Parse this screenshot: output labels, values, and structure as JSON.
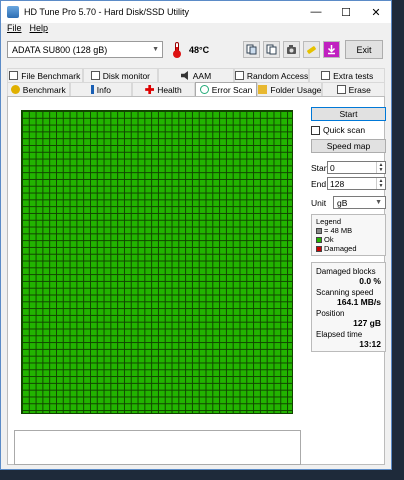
{
  "window": {
    "title": "HD Tune Pro 5.70 - Hard Disk/SSD Utility",
    "minimize": "—",
    "maximize": "☐",
    "close": "✕"
  },
  "menu": {
    "file": "File",
    "help": "Help"
  },
  "toolbar": {
    "drive": "ADATA SU800 (128 gB)",
    "temperature": "48°C",
    "exit_label": "Exit"
  },
  "tabs_row1": [
    "File Benchmark",
    "Disk monitor",
    "AAM",
    "Random Access",
    "Extra tests"
  ],
  "tabs_row2": [
    "Benchmark",
    "Info",
    "Health",
    "Error Scan",
    "Folder Usage",
    "Erase"
  ],
  "active_tab": "Error Scan",
  "controls": {
    "start_label": "Start",
    "quick_scan_label": "Quick scan",
    "speed_map_label": "Speed map",
    "start_field_label": "Start",
    "start_value": "0",
    "end_field_label": "End",
    "end_value": "128",
    "unit_label": "Unit",
    "unit_value": "gB"
  },
  "legend": {
    "title": "Legend",
    "block": "= 48 MB",
    "ok": "Ok",
    "damaged": "Damaged"
  },
  "stats": {
    "damaged_label": "Damaged blocks",
    "damaged_value": "0.0 %",
    "speed_label": "Scanning speed",
    "speed_value": "164.1 MB/s",
    "position_label": "Position",
    "position_value": "127 gB",
    "elapsed_label": "Elapsed time",
    "elapsed_value": "13:12"
  },
  "colors": {
    "ok": "#22b400",
    "damaged": "#cc0000",
    "block": "#888888",
    "accent": "#0078d7"
  }
}
